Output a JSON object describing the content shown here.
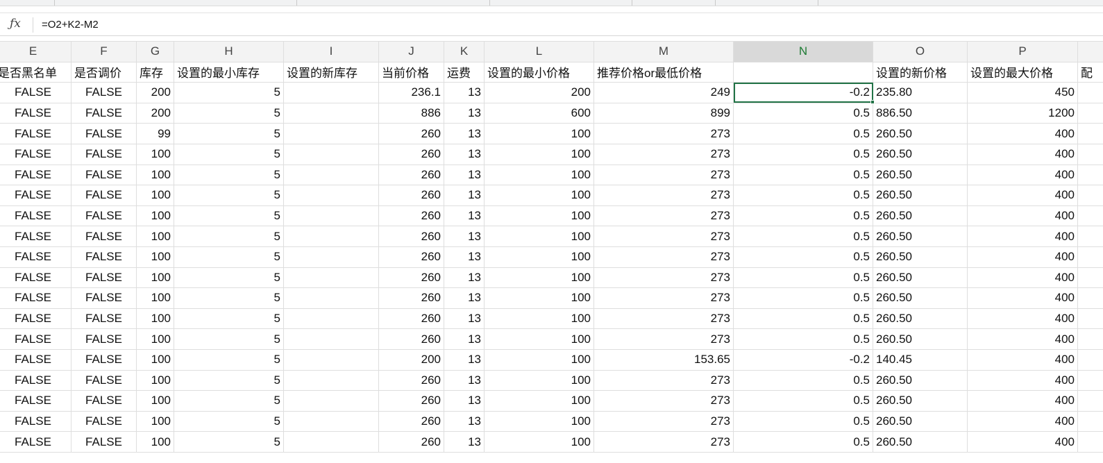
{
  "formula_bar": {
    "icon": "fx-icon",
    "formula": "=O2+K2-M2"
  },
  "columns": [
    "E",
    "F",
    "G",
    "H",
    "I",
    "J",
    "K",
    "L",
    "M",
    "N",
    "O",
    "P",
    ""
  ],
  "selected_column": "N",
  "field_row": [
    "是否黑名单",
    "是否调价",
    "库存",
    "设置的最小库存",
    "设置的新库存",
    "当前价格",
    "运费",
    "设置的最小价格",
    "推荐价格or最低价格",
    "",
    "设置的新价格",
    "设置的最大价格",
    "配"
  ],
  "rows": [
    [
      "FALSE",
      "FALSE",
      "200",
      "5",
      "",
      "236.1",
      "13",
      "200",
      "249",
      "-0.2",
      "235.80",
      "450",
      ""
    ],
    [
      "FALSE",
      "FALSE",
      "200",
      "5",
      "",
      "886",
      "13",
      "600",
      "899",
      "0.5",
      "886.50",
      "1200",
      ""
    ],
    [
      "FALSE",
      "FALSE",
      "99",
      "5",
      "",
      "260",
      "13",
      "100",
      "273",
      "0.5",
      "260.50",
      "400",
      ""
    ],
    [
      "FALSE",
      "FALSE",
      "100",
      "5",
      "",
      "260",
      "13",
      "100",
      "273",
      "0.5",
      "260.50",
      "400",
      ""
    ],
    [
      "FALSE",
      "FALSE",
      "100",
      "5",
      "",
      "260",
      "13",
      "100",
      "273",
      "0.5",
      "260.50",
      "400",
      ""
    ],
    [
      "FALSE",
      "FALSE",
      "100",
      "5",
      "",
      "260",
      "13",
      "100",
      "273",
      "0.5",
      "260.50",
      "400",
      ""
    ],
    [
      "FALSE",
      "FALSE",
      "100",
      "5",
      "",
      "260",
      "13",
      "100",
      "273",
      "0.5",
      "260.50",
      "400",
      ""
    ],
    [
      "FALSE",
      "FALSE",
      "100",
      "5",
      "",
      "260",
      "13",
      "100",
      "273",
      "0.5",
      "260.50",
      "400",
      ""
    ],
    [
      "FALSE",
      "FALSE",
      "100",
      "5",
      "",
      "260",
      "13",
      "100",
      "273",
      "0.5",
      "260.50",
      "400",
      ""
    ],
    [
      "FALSE",
      "FALSE",
      "100",
      "5",
      "",
      "260",
      "13",
      "100",
      "273",
      "0.5",
      "260.50",
      "400",
      ""
    ],
    [
      "FALSE",
      "FALSE",
      "100",
      "5",
      "",
      "260",
      "13",
      "100",
      "273",
      "0.5",
      "260.50",
      "400",
      ""
    ],
    [
      "FALSE",
      "FALSE",
      "100",
      "5",
      "",
      "260",
      "13",
      "100",
      "273",
      "0.5",
      "260.50",
      "400",
      ""
    ],
    [
      "FALSE",
      "FALSE",
      "100",
      "5",
      "",
      "260",
      "13",
      "100",
      "273",
      "0.5",
      "260.50",
      "400",
      ""
    ],
    [
      "FALSE",
      "FALSE",
      "100",
      "5",
      "",
      "200",
      "13",
      "100",
      "153.65",
      "-0.2",
      "140.45",
      "400",
      ""
    ],
    [
      "FALSE",
      "FALSE",
      "100",
      "5",
      "",
      "260",
      "13",
      "100",
      "273",
      "0.5",
      "260.50",
      "400",
      ""
    ],
    [
      "FALSE",
      "FALSE",
      "100",
      "5",
      "",
      "260",
      "13",
      "100",
      "273",
      "0.5",
      "260.50",
      "400",
      ""
    ],
    [
      "FALSE",
      "FALSE",
      "100",
      "5",
      "",
      "260",
      "13",
      "100",
      "273",
      "0.5",
      "260.50",
      "400",
      ""
    ],
    [
      "FALSE",
      "FALSE",
      "100",
      "5",
      "",
      "260",
      "13",
      "100",
      "273",
      "0.5",
      "260.50",
      "400",
      ""
    ]
  ],
  "colors": {
    "accent": "#217346",
    "selected_header_bg": "#d9d9d9",
    "selected_header_text": "#1e7b34",
    "header_bg": "#f3f3f3",
    "gridline": "#dedede"
  }
}
